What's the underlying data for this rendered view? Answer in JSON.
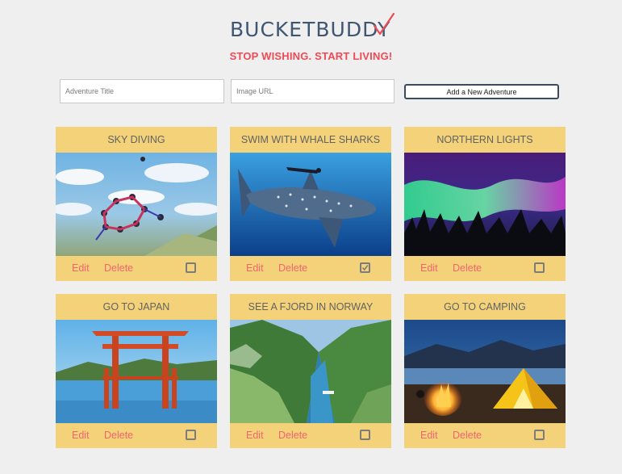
{
  "header": {
    "logo_text": "BUCKETBUDDY",
    "tagline": "STOP WISHING. START LIVING!"
  },
  "form": {
    "title_placeholder": "Adventure Title",
    "url_placeholder": "Image URL",
    "add_button_label": "Add a New Adventure"
  },
  "actions": {
    "edit_label": "Edit",
    "delete_label": "Delete"
  },
  "colors": {
    "card_bg": "#f3d27a",
    "accent": "#f04a55",
    "logo": "#3f5673"
  },
  "adventures": [
    {
      "title": "SKY DIVING",
      "image": "skydiving-photo",
      "checked": false
    },
    {
      "title": "SWIM WITH WHALE SHARKS",
      "image": "whale-shark-photo",
      "checked": true
    },
    {
      "title": "NORTHERN LIGHTS",
      "image": "aurora-photo",
      "checked": false
    },
    {
      "title": "GO TO JAPAN",
      "image": "torii-gate-photo",
      "checked": false
    },
    {
      "title": "SEE A FJORD IN NORWAY",
      "image": "fjord-photo",
      "checked": false
    },
    {
      "title": "GO TO CAMPING",
      "image": "campfire-tent-photo",
      "checked": false
    }
  ]
}
